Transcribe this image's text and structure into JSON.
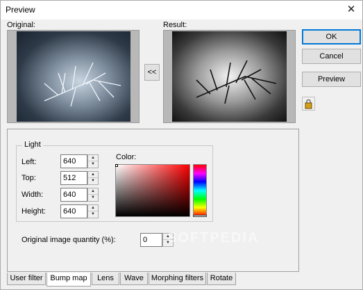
{
  "window": {
    "title": "Preview",
    "close_glyph": "✕"
  },
  "labels": {
    "original": "Original:",
    "result": "Result:"
  },
  "buttons": {
    "ok": "OK",
    "cancel": "Cancel",
    "preview": "Preview",
    "copy_arrow": "<<",
    "lock_icon": "lock-icon"
  },
  "light": {
    "title": "Light",
    "left_label": "Left:",
    "left_value": "640",
    "top_label": "Top:",
    "top_value": "512",
    "width_label": "Width:",
    "width_value": "640",
    "height_label": "Height:",
    "height_value": "640"
  },
  "color": {
    "label": "Color:",
    "base": "#ff0000"
  },
  "quantity": {
    "label": "Original image quantity (%):",
    "value": "0"
  },
  "tabs": [
    "User filter",
    "Bump map",
    "Lens",
    "Wave",
    "Morphing filters",
    "Rotate"
  ],
  "active_tab": "Bump map",
  "watermark": "SOFTPEDIA"
}
